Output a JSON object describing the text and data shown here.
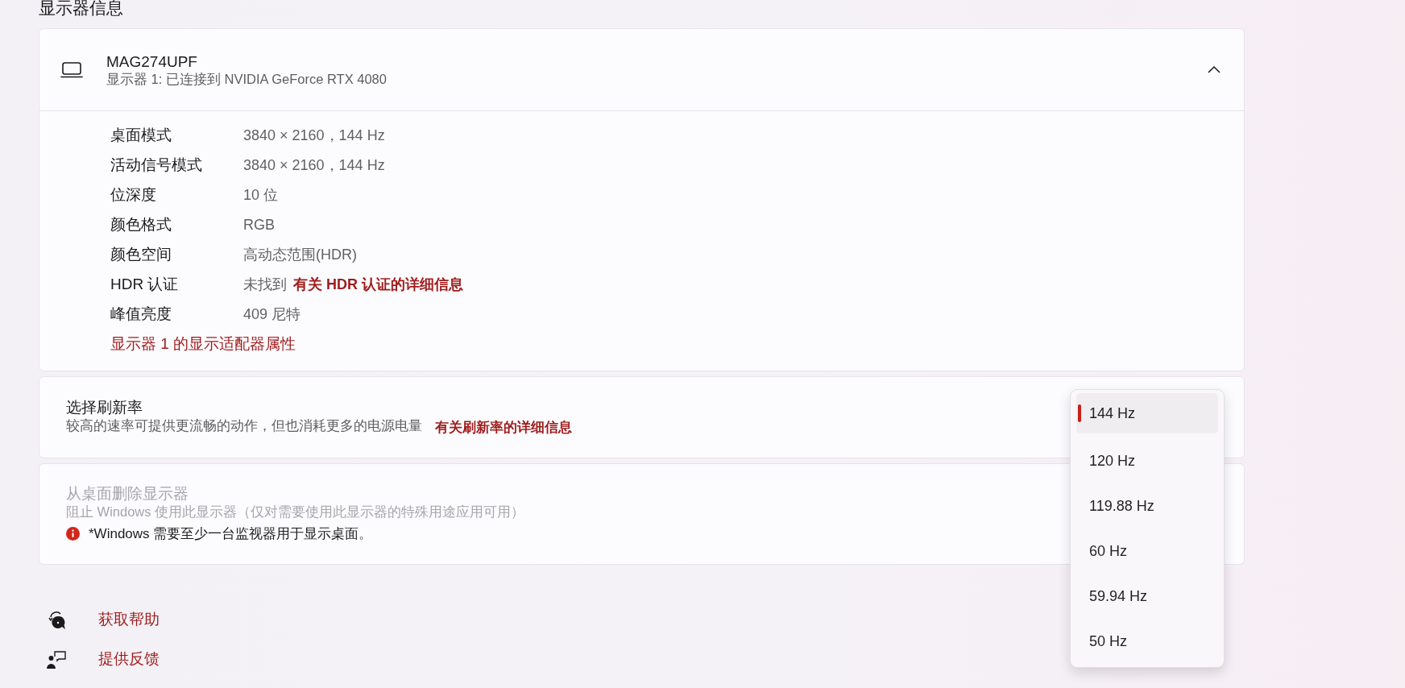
{
  "section_title": "显示器信息",
  "monitor": {
    "name": "MAG274UPF",
    "subtitle": "显示器 1: 已连接到 NVIDIA GeForce RTX 4080",
    "expanded": true,
    "properties": [
      {
        "label": "桌面模式",
        "value": "3840 × 2160，144 Hz"
      },
      {
        "label": "活动信号模式",
        "value": "3840 × 2160，144 Hz"
      },
      {
        "label": "位深度",
        "value": "10 位"
      },
      {
        "label": "颜色格式",
        "value": "RGB"
      },
      {
        "label": "颜色空间",
        "value": "高动态范围(HDR)"
      },
      {
        "label": "HDR 认证",
        "value": "未找到",
        "link": "有关 HDR 认证的详细信息"
      },
      {
        "label": "峰值亮度",
        "value": "409 尼特"
      }
    ],
    "adapter_link": "显示器 1 的显示适配器属性"
  },
  "refresh_rate": {
    "title": "选择刷新率",
    "description": "较高的速率可提供更流畅的动作，但也消耗更多的电源电量",
    "link": "有关刷新率的详细信息",
    "options": [
      {
        "label": "144 Hz",
        "selected": true
      },
      {
        "label": "120 Hz",
        "selected": false
      },
      {
        "label": "119.88 Hz",
        "selected": false
      },
      {
        "label": "60 Hz",
        "selected": false
      },
      {
        "label": "59.94 Hz",
        "selected": false
      },
      {
        "label": "50 Hz",
        "selected": false
      }
    ]
  },
  "remove_display": {
    "title": "从桌面删除显示器",
    "description": "阻止 Windows 使用此显示器（仅对需要使用此显示器的特殊用途应用可用）",
    "disabled": true,
    "warning": "*Windows 需要至少一台监视器用于显示桌面。"
  },
  "help_links": [
    {
      "kind": "help",
      "label": "获取帮助"
    },
    {
      "kind": "feedback",
      "label": "提供反馈"
    }
  ]
}
